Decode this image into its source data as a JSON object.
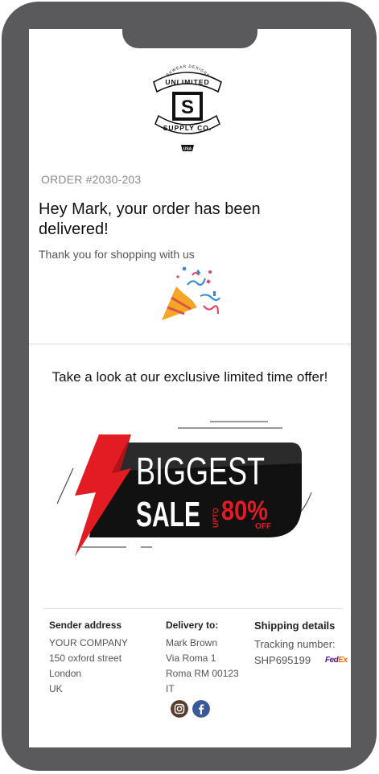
{
  "logo": {
    "top_text": "WORKWEAR DESIGNERS",
    "brand_line1": "UNLIMITED",
    "brand_line2": "SUPPLY CO.",
    "monogram": "S",
    "origin_badge": "USA"
  },
  "order": {
    "number": "ORDER #2030-203",
    "headline": "Hey Mark, your order has been delivered!",
    "thanks": "Thank you for shopping with us"
  },
  "offer": {
    "title": "Take a look at our exclusive limited time offer!",
    "banner_line1": "BIGGEST",
    "banner_line2": "SALE",
    "banner_upto": "UPTO",
    "banner_percent": "80%",
    "banner_off": "OFF"
  },
  "sender": {
    "title": "Sender address",
    "lines": [
      "YOUR COMPANY",
      "150 oxford street",
      "London",
      "UK"
    ]
  },
  "delivery": {
    "title": "Delivery to:",
    "lines": [
      "Mark Brown",
      "Via Roma 1",
      "Roma RM 00123",
      "IT"
    ]
  },
  "shipping": {
    "title": "Shipping details",
    "tracking_label": "Tracking number:",
    "tracking_number": "SHP695199",
    "carrier_fe": "Fed",
    "carrier_ex": "Ex"
  },
  "social": {
    "instagram_icon": "instagram-icon",
    "facebook_icon": "facebook-icon",
    "instagram_color": "#5b3a2e",
    "facebook_color": "#3b5998"
  },
  "colors": {
    "phone_frame": "#5a5a5c",
    "sale_red": "#e31b23",
    "sale_black": "#111111"
  }
}
